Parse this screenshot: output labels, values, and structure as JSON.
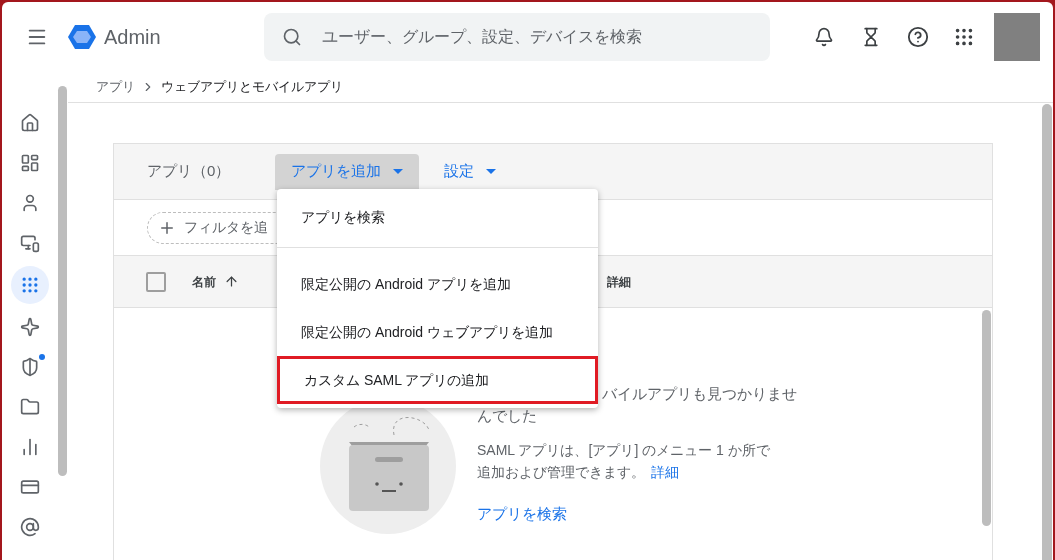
{
  "header": {
    "app_name": "Admin",
    "search": {
      "placeholder": "ユーザー、グループ、設定、デバイスを検索"
    }
  },
  "breadcrumb": [
    {
      "label": "アプリ",
      "current": false
    },
    {
      "label": "ウェブアプリとモバイルアプリ",
      "current": true
    }
  ],
  "sidebar": {
    "items": [
      {
        "kind": "home",
        "selected": false,
        "notification": false
      },
      {
        "kind": "dashboard",
        "selected": false,
        "notification": false
      },
      {
        "kind": "user",
        "selected": false,
        "notification": false
      },
      {
        "kind": "devices",
        "selected": false,
        "notification": false
      },
      {
        "kind": "apps",
        "selected": true,
        "notification": false
      },
      {
        "kind": "sparkle",
        "selected": false,
        "notification": false
      },
      {
        "kind": "security",
        "selected": false,
        "notification": true
      },
      {
        "kind": "folder",
        "selected": false,
        "notification": false
      },
      {
        "kind": "reports",
        "selected": false,
        "notification": false
      },
      {
        "kind": "billing",
        "selected": false,
        "notification": false
      },
      {
        "kind": "account",
        "selected": false,
        "notification": false
      }
    ]
  },
  "toolbar": {
    "title": "アプリ（0）",
    "add_button": {
      "label": "アプリを追加",
      "expanded": true
    },
    "settings_button": {
      "label": "設定"
    }
  },
  "filter": {
    "label": "フィルタを追"
  },
  "table": {
    "select_all": {
      "checked": false
    },
    "columns": [
      {
        "label": "名前",
        "sorted": true
      },
      {
        "label": "詳細",
        "sorted": false
      }
    ]
  },
  "menu": {
    "sections": [
      [
        {
          "label": "アプリを検索",
          "highlighted": false
        }
      ],
      [
        {
          "label": "限定公開の Android アプリを追加",
          "highlighted": false
        },
        {
          "label": "限定公開の Android ウェブアプリを追加",
          "highlighted": false
        },
        {
          "label": "カスタム SAML アプリの追加",
          "highlighted": true
        }
      ]
    ]
  },
  "empty_state": {
    "title_lines": [
      "バイルアプリも見つかりませ",
      "んでした"
    ],
    "description_lines": [
      "SAML アプリは、[アプリ] のメニュー 1 か所で",
      "追加および管理できます。"
    ],
    "learn_more": "詳細",
    "action": "アプリを検索"
  }
}
